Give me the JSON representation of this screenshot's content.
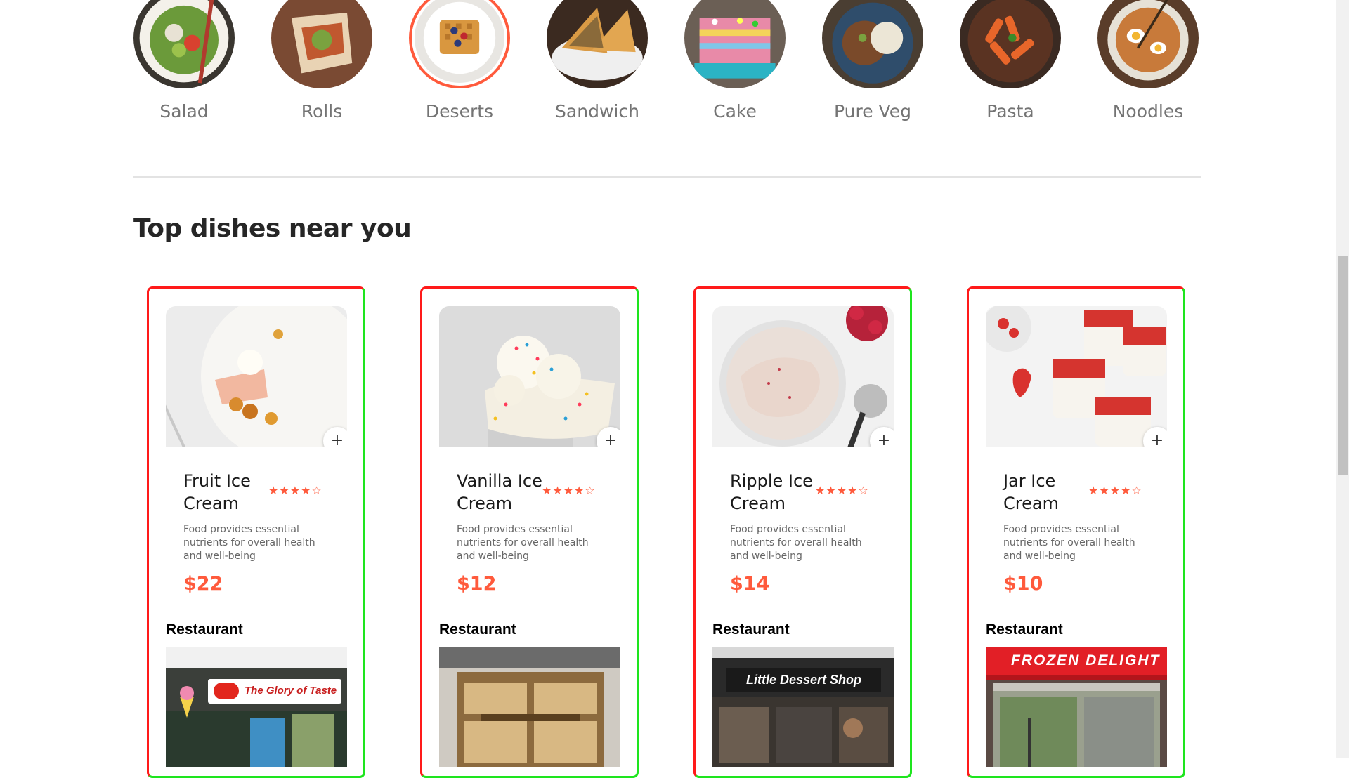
{
  "categories": [
    {
      "label": "Salad",
      "icon": "salad-image",
      "active": false
    },
    {
      "label": "Rolls",
      "icon": "rolls-image",
      "active": false
    },
    {
      "label": "Deserts",
      "icon": "deserts-image",
      "active": true
    },
    {
      "label": "Sandwich",
      "icon": "sandwich-image",
      "active": false
    },
    {
      "label": "Cake",
      "icon": "cake-image",
      "active": false
    },
    {
      "label": "Pure Veg",
      "icon": "pure-veg-image",
      "active": false
    },
    {
      "label": "Pasta",
      "icon": "pasta-image",
      "active": false
    },
    {
      "label": "Noodles",
      "icon": "noodles-image",
      "active": false
    }
  ],
  "section_title": "Top dishes near you",
  "dishes": [
    {
      "name": "Fruit Ice Cream",
      "rating": 4,
      "rating_max": 5,
      "description": "Food provides essential nutrients for overall health and well-being",
      "price": "$22",
      "add_label": "+",
      "restaurant_label": "Restaurant",
      "restaurant_sign": "The Glory of Taste"
    },
    {
      "name": "Vanilla Ice Cream",
      "rating": 4,
      "rating_max": 5,
      "description": "Food provides essential nutrients for overall health and well-being",
      "price": "$12",
      "add_label": "+",
      "restaurant_label": "Restaurant",
      "restaurant_sign": ""
    },
    {
      "name": "Ripple Ice Cream",
      "rating": 4,
      "rating_max": 5,
      "description": "Food provides essential nutrients for overall health and well-being",
      "price": "$14",
      "add_label": "+",
      "restaurant_label": "Restaurant",
      "restaurant_sign": "Little Dessert Shop"
    },
    {
      "name": "Jar Ice Cream",
      "rating": 4,
      "rating_max": 5,
      "description": "Food provides essential nutrients for overall health and well-being",
      "price": "$10",
      "add_label": "+",
      "restaurant_label": "Restaurant",
      "restaurant_sign": "FROZEN DELIGHT"
    }
  ],
  "colors": {
    "accent": "#ff5a3c",
    "card_border_left_top": "#ff1a1a",
    "card_border_right_bottom": "#1ee51e"
  }
}
